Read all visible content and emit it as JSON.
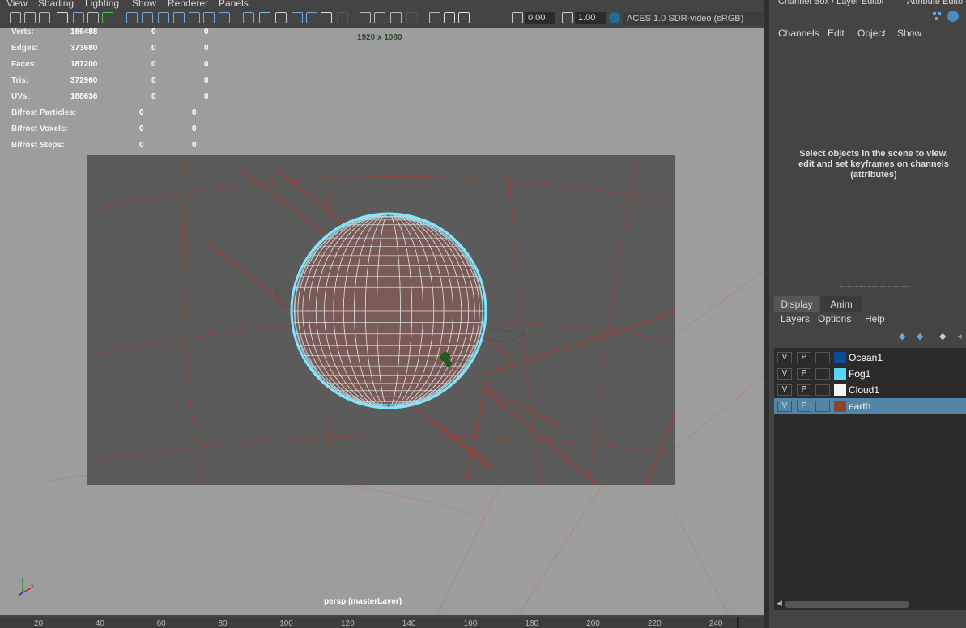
{
  "menu": {
    "items": [
      "View",
      "Shading",
      "Lighting",
      "Show",
      "Renderer",
      "Panels"
    ]
  },
  "toolbar": {
    "exposure": "0.00",
    "gamma": "1.00",
    "colorspace": "ACES 1.0 SDR-video (sRGB)",
    "icons": [
      "camera-icon",
      "lock-camera-icon",
      "camera-attr-icon",
      "bookmark-icon",
      "image-plane-icon",
      "2d-pan-zoom-icon",
      "grease-pencil-icon",
      "grid-icon",
      "film-gate-icon",
      "resolution-gate-icon",
      "gate-mask-icon",
      "field-chart-icon",
      "safe-action-icon",
      "safe-title-icon",
      "wireframe-icon",
      "smooth-shade-icon",
      "default-material-icon",
      "wireframe-on-shaded-icon",
      "xray-icon",
      "lights-icon",
      "shadows-icon",
      "ambient-occlusion-icon",
      "motion-blur-icon",
      "anti-alias-icon",
      "depth-of-field-icon",
      "isolate-select-icon",
      "xray-joints-icon",
      "textures-icon",
      "exposure-icon",
      "gamma-icon",
      "color-management-icon"
    ]
  },
  "hud": {
    "rows": [
      {
        "label": "Verts:",
        "a": "186488",
        "b": "0",
        "c": "0"
      },
      {
        "label": "Edges:",
        "a": "373680",
        "b": "0",
        "c": "0"
      },
      {
        "label": "Faces:",
        "a": "187200",
        "b": "0",
        "c": "0"
      },
      {
        "label": "Tris:",
        "a": "372960",
        "b": "0",
        "c": "0"
      },
      {
        "label": "UVs:",
        "a": "188636",
        "b": "0",
        "c": "0"
      }
    ],
    "bifrost": [
      {
        "label": "Bifrost Particles:",
        "a": "0",
        "b": "0"
      },
      {
        "label": "Bifrost Voxels:",
        "a": "0",
        "b": "0"
      },
      {
        "label": "Bifrost Steps:",
        "a": "0",
        "b": "0"
      }
    ],
    "resolution": "1920 x 1080",
    "camera": "persp (masterLayer)"
  },
  "channel_box": {
    "title": "Channel Box / Layer Editor",
    "attr_tab": "Attribute Edito",
    "menu": [
      "Channels",
      "Edit",
      "Object",
      "Show"
    ],
    "message": "Select objects in the scene to view, edit and set keyframes on channels (attributes)"
  },
  "layer_editor": {
    "tabs": [
      "Display",
      "Anim"
    ],
    "menu": [
      "Layers",
      "Options",
      "Help"
    ],
    "layers": [
      {
        "v": "V",
        "p": "P",
        "name": "Ocean1",
        "color": "#0a4a9a",
        "selected": false
      },
      {
        "v": "V",
        "p": "P",
        "name": "Fog1",
        "color": "#5ad4f0",
        "selected": false
      },
      {
        "v": "V",
        "p": "P",
        "name": "Cloud1",
        "color": "#f4f4f4",
        "selected": false
      },
      {
        "v": "V",
        "p": "P",
        "name": "earth",
        "color": "#8a4434",
        "selected": true
      }
    ]
  },
  "timeline": {
    "ticks": [
      "20",
      "40",
      "60",
      "80",
      "100",
      "120",
      "140",
      "160",
      "180",
      "200",
      "220",
      "240"
    ]
  },
  "colors": {
    "viewport_bg": "#9d9d9d",
    "gate_bg": "#5b5b5b",
    "sphere_wire": "#7fe6ff",
    "grid_red": "#b03a2e",
    "selected_layer": "#5285a6"
  }
}
